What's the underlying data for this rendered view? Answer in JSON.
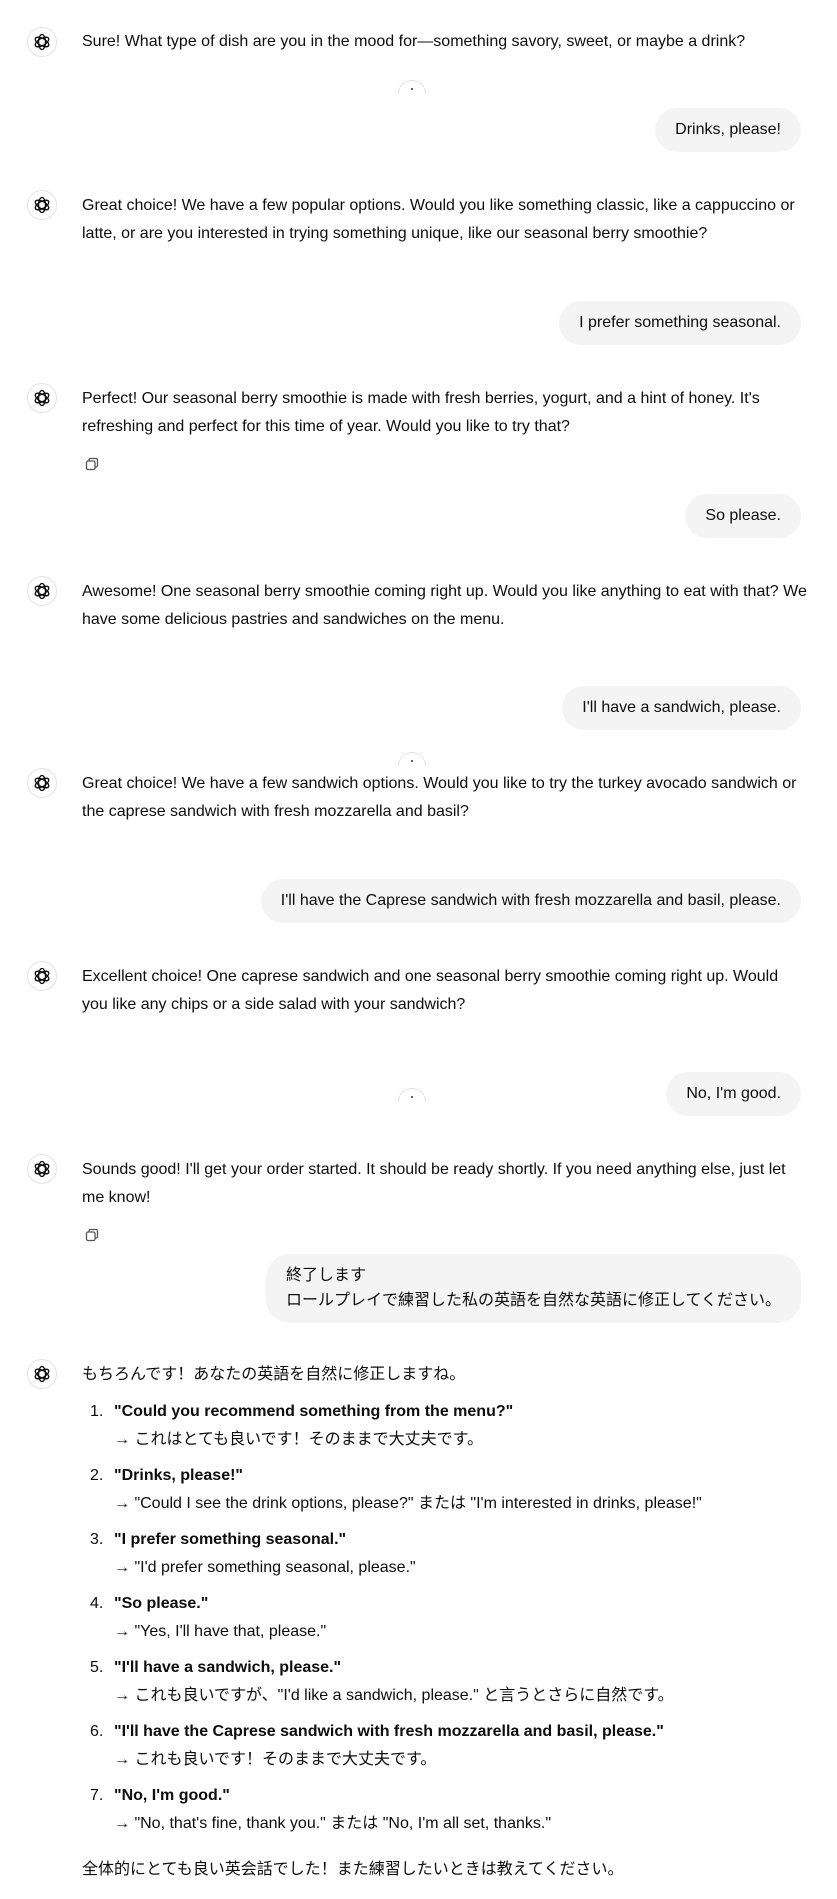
{
  "messages": [
    {
      "role": "assistant",
      "text": "Sure! What type of dish are you in the mood for—something savory, sweet, or maybe a drink?"
    },
    {
      "role": "user",
      "text": "Drinks, please!"
    },
    {
      "role": "assistant",
      "text": "Great choice! We have a few popular options. Would you like something classic, like a cappuccino or latte, or are you interested in trying something unique, like our seasonal berry smoothie?"
    },
    {
      "role": "user",
      "text": "I prefer something seasonal."
    },
    {
      "role": "assistant",
      "text": "Perfect! Our seasonal berry smoothie is made with fresh berries, yogurt, and a hint of honey. It's refreshing and perfect for this time of year. Would you like to try that?"
    },
    {
      "role": "user",
      "text": "So please."
    },
    {
      "role": "assistant",
      "text": "Awesome! One seasonal berry smoothie coming right up. Would you like anything to eat with that? We have some delicious pastries and sandwiches on the menu."
    },
    {
      "role": "user",
      "text": "I'll have a sandwich, please."
    },
    {
      "role": "assistant",
      "text": "Great choice! We have a few sandwich options. Would you like to try the turkey avocado sandwich or the caprese sandwich with fresh mozzarella and basil?"
    },
    {
      "role": "user",
      "text": "I'll have the Caprese sandwich with fresh mozzarella and basil, please."
    },
    {
      "role": "assistant",
      "text": "Excellent choice! One caprese sandwich and one seasonal berry smoothie coming right up. Would you like any chips or a side salad with your sandwich?"
    },
    {
      "role": "user",
      "text": "No, I'm good."
    },
    {
      "role": "assistant",
      "text": "Sounds good! I'll get your order started. It should be ready shortly. If you need anything else, just let me know!"
    },
    {
      "role": "user",
      "lines": [
        "終了します",
        "ロールプレイで練習した私の英語を自然な英語に修正してください。"
      ]
    }
  ],
  "final_reply": {
    "intro": "もちろんです！あなたの英語を自然に修正しますね。",
    "items": [
      {
        "num": "1.",
        "quote": "\"Could you recommend something from the menu?\"",
        "fix": "→ これはとても良いです！そのままで大丈夫です。"
      },
      {
        "num": "2.",
        "quote": "\"Drinks, please!\"",
        "fix": "→ \"Could I see the drink options, please?\" または \"I'm interested in drinks, please!\""
      },
      {
        "num": "3.",
        "quote": "\"I prefer something seasonal.\"",
        "fix": "→ \"I'd prefer something seasonal, please.\""
      },
      {
        "num": "4.",
        "quote": "\"So please.\"",
        "fix": "→ \"Yes, I'll have that, please.\""
      },
      {
        "num": "5.",
        "quote": "\"I'll have a sandwich, please.\"",
        "fix": "→ これも良いですが、\"I'd like a sandwich, please.\" と言うとさらに自然です。"
      },
      {
        "num": "6.",
        "quote": "\"I'll have the Caprese sandwich with fresh mozzarella and basil, please.\"",
        "fix": "→ これも良いです！そのままで大丈夫です。"
      },
      {
        "num": "7.",
        "quote": "\"No, I'm good.\"",
        "fix": "→ \"No, that's fine, thank you.\" または \"No, I'm all set, thanks.\""
      }
    ],
    "outro": "全体的にとても良い英会話でした！また練習したいときは教えてください。"
  },
  "icons": {
    "avatar": "openai-logo-icon",
    "copy": "copy-icon"
  },
  "colors": {
    "bubble_bg": "#f4f4f4",
    "text": "#0d0d0d",
    "avatar_border": "#e3e3e3"
  }
}
